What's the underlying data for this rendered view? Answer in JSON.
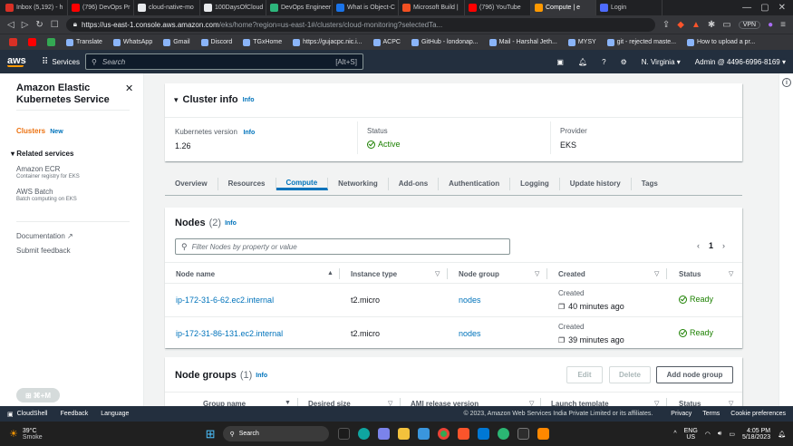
{
  "browser": {
    "tabs": [
      {
        "label": "Inbox (5,192) - h",
        "color": "#d93025"
      },
      {
        "label": "(796) DevOps Pr",
        "color": "#ff0000"
      },
      {
        "label": "cloud-native-mo",
        "color": "#e8eaed"
      },
      {
        "label": "100DaysOfCloud",
        "color": "#e8eaed"
      },
      {
        "label": "DevOps Engineer",
        "color": "#2db67c"
      },
      {
        "label": "What is Object-C",
        "color": "#1a73e8"
      },
      {
        "label": "Microsoft Build |",
        "color": "#f25022"
      },
      {
        "label": "(796) YouTube",
        "color": "#ff0000"
      },
      {
        "label": "Compute | e",
        "color": "#ff9900"
      },
      {
        "label": "Login",
        "color": "#4d6bfe"
      }
    ],
    "url_host": "https://us-east-1.console.aws.amazon.com",
    "url_path": "/eks/home?region=us-east-1#/clusters/cloud-monitoring?selectedTa...",
    "vpn": "VPN",
    "bookmarks": [
      "Translate",
      "WhatsApp",
      "Gmail",
      "Discord",
      "TGxHome",
      "https://gujacpc.nic.i...",
      "ACPC",
      "GitHub - londonap...",
      "Mail - Harshal Jeth...",
      "MYSY",
      "git - rejected maste...",
      "How to upload a pr..."
    ]
  },
  "aws": {
    "logo": "aws",
    "services": "Services",
    "search_placeholder": "Search",
    "search_shortcut": "[Alt+S]",
    "region": "N. Virginia",
    "account": "Admin @ 4496-6996-8169"
  },
  "sidebar": {
    "title": "Amazon Elastic Kubernetes Service",
    "clusters": "Clusters",
    "new_badge": "New",
    "related": "Related services",
    "ecr": "Amazon ECR",
    "ecr_sub": "Container registry for EKS",
    "batch": "AWS Batch",
    "batch_sub": "Batch computing on EKS",
    "documentation": "Documentation",
    "feedback": "Submit feedback",
    "shortcut": "⌘+M"
  },
  "cluster_info": {
    "title": "Cluster info",
    "info": "Info",
    "k8s_label": "Kubernetes version",
    "k8s_info": "Info",
    "k8s_value": "1.26",
    "status_label": "Status",
    "status_value": "Active",
    "provider_label": "Provider",
    "provider_value": "EKS"
  },
  "tabs": [
    "Overview",
    "Resources",
    "Compute",
    "Networking",
    "Add-ons",
    "Authentication",
    "Logging",
    "Update history",
    "Tags"
  ],
  "active_tab": "Compute",
  "nodes": {
    "title": "Nodes",
    "count": "(2)",
    "info": "Info",
    "filter_placeholder": "Filter Nodes by property or value",
    "page": "1",
    "columns": [
      "Node name",
      "Instance type",
      "Node group",
      "Created",
      "Status"
    ],
    "rows": [
      {
        "name": "ip-172-31-6-62.ec2.internal",
        "type": "t2.micro",
        "group": "nodes",
        "created_label": "Created",
        "created": "40 minutes ago",
        "status": "Ready"
      },
      {
        "name": "ip-172-31-86-131.ec2.internal",
        "type": "t2.micro",
        "group": "nodes",
        "created_label": "Created",
        "created": "39 minutes ago",
        "status": "Ready"
      }
    ]
  },
  "node_groups": {
    "title": "Node groups",
    "count": "(1)",
    "info": "Info",
    "edit": "Edit",
    "delete": "Delete",
    "add": "Add node group",
    "columns": [
      "Group name",
      "Desired size",
      "AMI release version",
      "Launch template",
      "Status"
    ]
  },
  "footer": {
    "cloudshell": "CloudShell",
    "feedback": "Feedback",
    "language": "Language",
    "copyright": "© 2023, Amazon Web Services India Private Limited or its affiliates.",
    "privacy": "Privacy",
    "terms": "Terms",
    "cookie": "Cookie preferences"
  },
  "taskbar": {
    "temp": "39°C",
    "weather": "Smoke",
    "search": "Search",
    "lang1": "ENG",
    "lang2": "US",
    "time": "4:05 PM",
    "date": "5/18/2023"
  },
  "colors": {
    "aws_nav": "#232f3e",
    "link": "#0073bb",
    "success": "#1d8102",
    "accent": "#ec7211"
  }
}
